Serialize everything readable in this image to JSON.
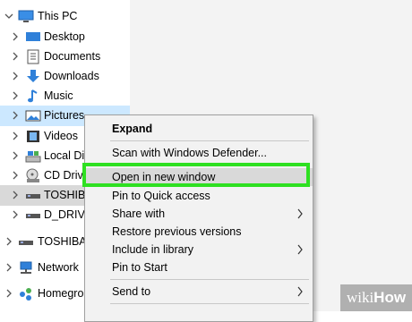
{
  "nav": {
    "items": [
      {
        "label": "This PC",
        "icon": "monitor-icon"
      },
      {
        "label": "Desktop",
        "icon": "desktop-folder-icon"
      },
      {
        "label": "Documents",
        "icon": "documents-icon"
      },
      {
        "label": "Downloads",
        "icon": "downloads-icon"
      },
      {
        "label": "Music",
        "icon": "music-icon"
      },
      {
        "label": "Pictures",
        "icon": "pictures-icon"
      },
      {
        "label": "Videos",
        "icon": "videos-icon"
      },
      {
        "label": "Local Dis",
        "icon": "local-disk-icon"
      },
      {
        "label": "CD Drive",
        "icon": "cd-drive-icon"
      },
      {
        "label": "TOSHIBA",
        "icon": "usb-drive-icon"
      },
      {
        "label": "D_DRIVE",
        "icon": "drive-icon"
      },
      {
        "label": "TOSHIBA (",
        "icon": "usb-drive-icon"
      },
      {
        "label": "Network",
        "icon": "network-icon"
      },
      {
        "label": "Homegrou",
        "icon": "homegroup-icon"
      }
    ]
  },
  "context_menu": {
    "items": [
      {
        "label": "Expand",
        "bold": true
      },
      {
        "label": "Scan with Windows Defender..."
      },
      {
        "label": "Open in new window",
        "highlighted": true
      },
      {
        "label": "Pin to Quick access"
      },
      {
        "label": "Share with",
        "submenu": true
      },
      {
        "label": "Restore previous versions"
      },
      {
        "label": "Include in library",
        "submenu": true
      },
      {
        "label": "Pin to Start"
      },
      {
        "label": "Send to",
        "submenu": true
      }
    ]
  },
  "watermark": {
    "prefix": "wiki",
    "suffix": "How"
  },
  "colors": {
    "selection": "#cce8ff",
    "highlight_box": "#2ee021",
    "menu_bg": "#f2f2f2"
  }
}
